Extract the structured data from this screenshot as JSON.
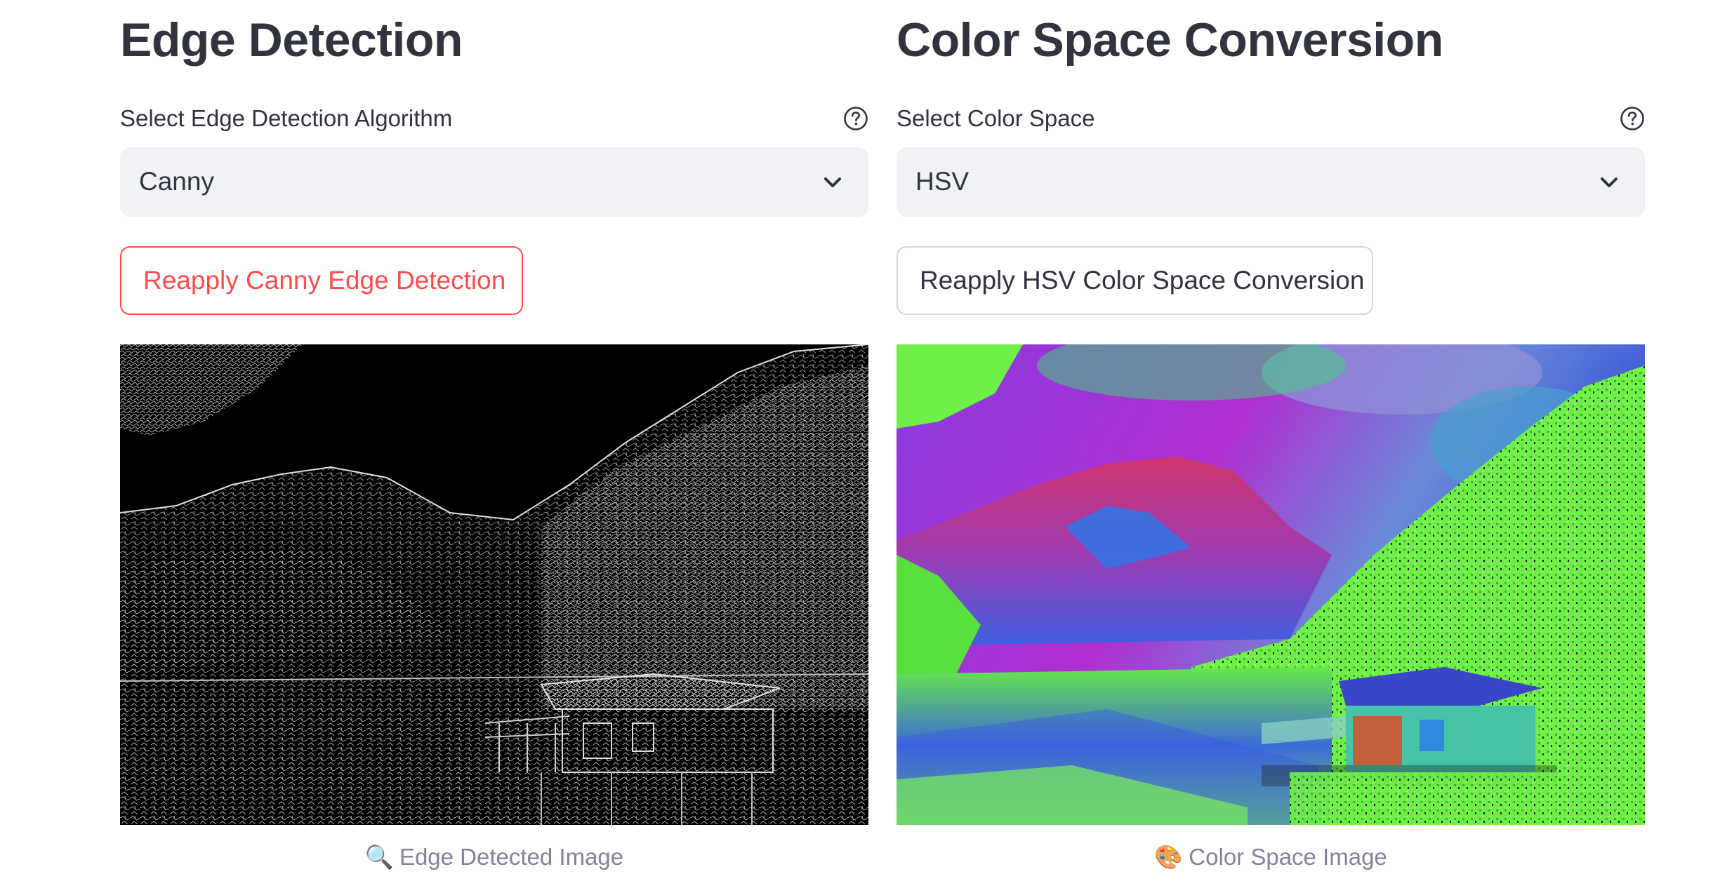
{
  "edge": {
    "heading": "Edge Detection",
    "select_label": "Select Edge Detection Algorithm",
    "select_value": "Canny",
    "button_label": "Reapply Canny Edge Detection",
    "caption_icon": "🔍",
    "caption": "Edge Detected Image",
    "help_icon": "question-circle-icon",
    "accent_color": "#ff4b4b"
  },
  "color": {
    "heading": "Color Space Conversion",
    "select_label": "Select Color Space",
    "select_value": "HSV",
    "button_label": "Reapply HSV Color Space Conversion",
    "caption_icon": "🎨",
    "caption": "Color Space Image",
    "help_icon": "question-circle-icon"
  }
}
